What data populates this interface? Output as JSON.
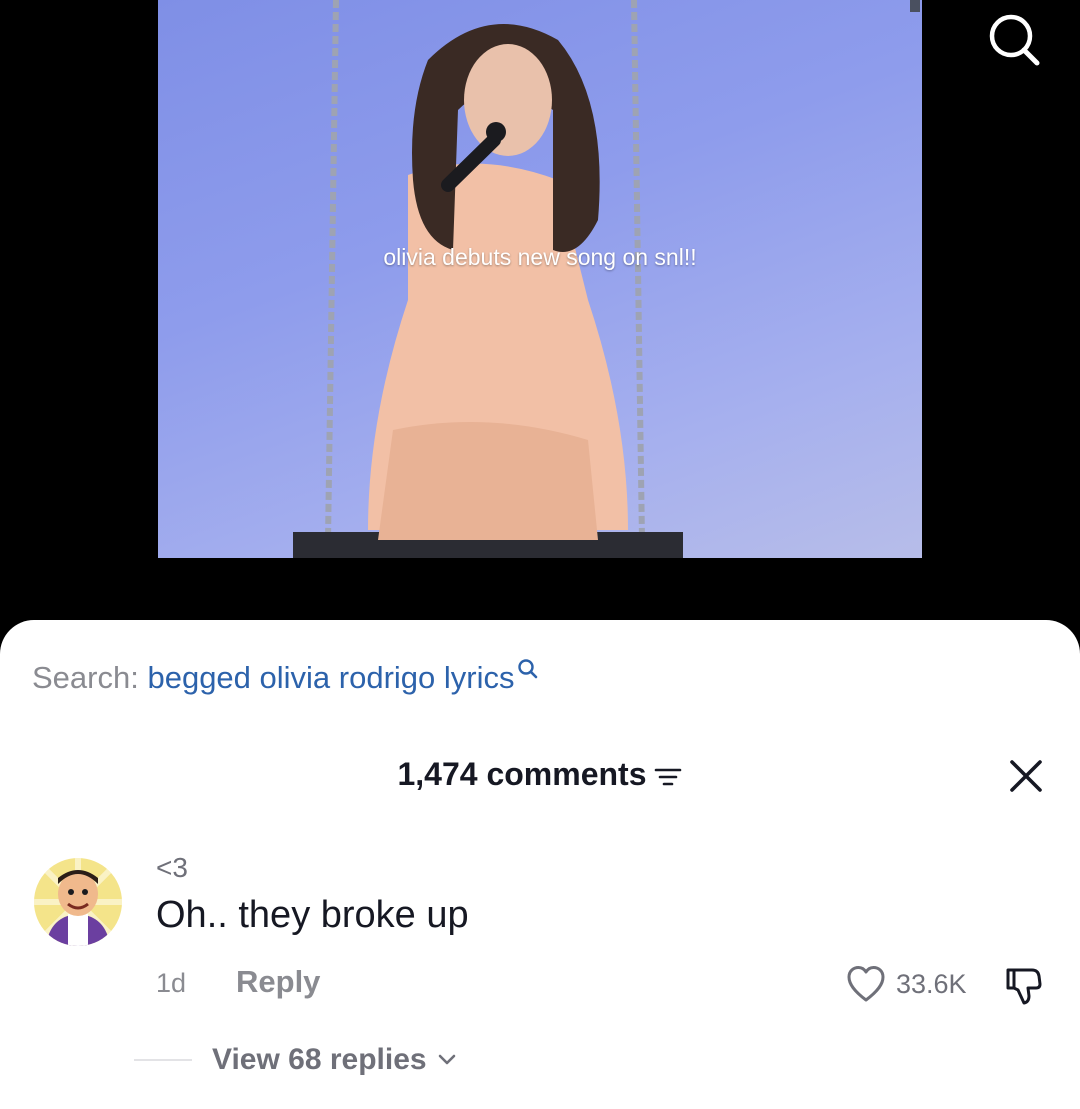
{
  "video": {
    "caption": "olivia debuts new song on snl!!",
    "background_color": "#8e9cec"
  },
  "icons": {
    "top_search": "search-icon",
    "query_search": "search-icon",
    "sort": "sort-icon",
    "close": "close-icon",
    "like": "heart-icon",
    "dislike": "thumbs-down-icon",
    "replies": "chevron-down-icon"
  },
  "search": {
    "prefix": "Search:",
    "query": "begged olivia rodrigo lyrics",
    "query_color": "#2c62ab"
  },
  "comments_header": {
    "count_label": "1,474 comments"
  },
  "comment": {
    "username": "<3",
    "text": "Oh.. they broke up",
    "time": "1d",
    "reply_label": "Reply",
    "like_count": "33.6K",
    "view_replies_label": "View 68 replies"
  }
}
